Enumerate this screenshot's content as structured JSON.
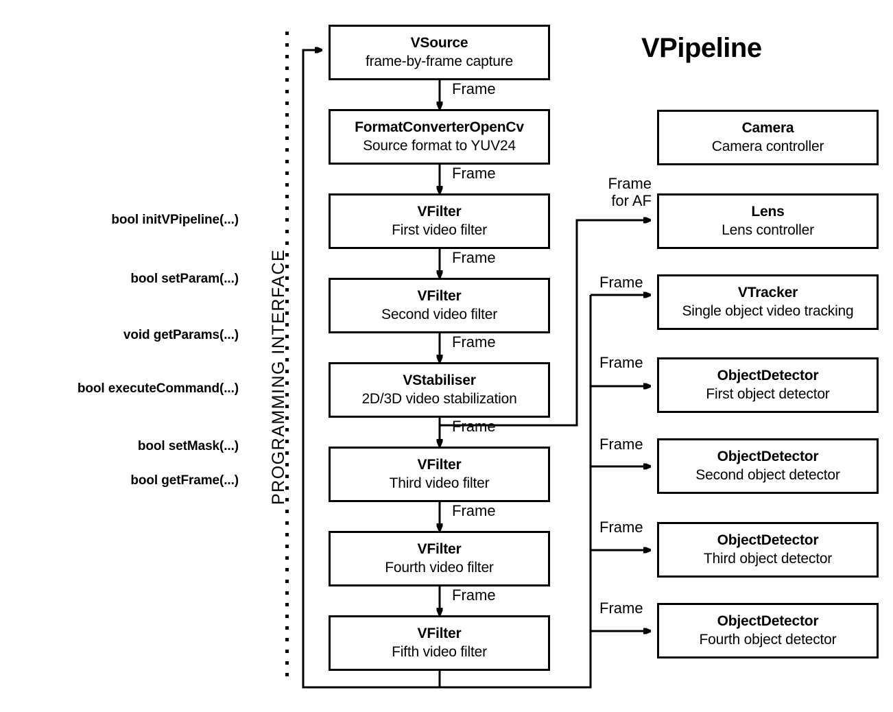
{
  "title": "VPipeline",
  "vertical_label": "PROGRAMMING INTERFACE",
  "api": {
    "methods": [
      {
        "label": "bool initVPipeline(...)"
      },
      {
        "label": "bool setParam(...)"
      },
      {
        "label": "void getParams(...)"
      },
      {
        "label": "bool executeCommand(...)"
      },
      {
        "label": "bool setMask(...)"
      },
      {
        "label": "bool getFrame(...)"
      }
    ]
  },
  "pipeline": {
    "nodes": [
      {
        "name": "VSource",
        "desc": "frame-by-frame capture"
      },
      {
        "name": "FormatConverterOpenCv",
        "desc": "Source format to YUV24"
      },
      {
        "name": "VFilter",
        "desc": "First video filter"
      },
      {
        "name": "VFilter",
        "desc": "Second video filter"
      },
      {
        "name": "VStabiliser",
        "desc": "2D/3D video stabilization"
      },
      {
        "name": "VFilter",
        "desc": "Third video filter"
      },
      {
        "name": "VFilter",
        "desc": "Fourth video filter"
      },
      {
        "name": "VFilter",
        "desc": "Fifth video filter"
      }
    ],
    "edge_labels": [
      {
        "label": "Frame"
      },
      {
        "label": "Frame"
      },
      {
        "label": "Frame"
      },
      {
        "label": "Frame"
      },
      {
        "label": "Frame"
      },
      {
        "label": "Frame"
      },
      {
        "label": "Frame"
      }
    ]
  },
  "consumers": {
    "nodes": [
      {
        "name": "Camera",
        "desc": "Camera controller"
      },
      {
        "name": "Lens",
        "desc": "Lens controller"
      },
      {
        "name": "VTracker",
        "desc": "Single object video tracking"
      },
      {
        "name": "ObjectDetector",
        "desc": "First object detector"
      },
      {
        "name": "ObjectDetector",
        "desc": "Second object detector"
      },
      {
        "name": "ObjectDetector",
        "desc": "Third object detector"
      },
      {
        "name": "ObjectDetector",
        "desc": "Fourth object detector"
      }
    ],
    "edge_labels": [
      {
        "label": "Frame\nfor AF"
      },
      {
        "label": "Frame"
      },
      {
        "label": "Frame"
      },
      {
        "label": "Frame"
      },
      {
        "label": "Frame"
      },
      {
        "label": "Frame"
      }
    ]
  },
  "colors": {
    "stroke": "#000000",
    "background": "#ffffff"
  }
}
